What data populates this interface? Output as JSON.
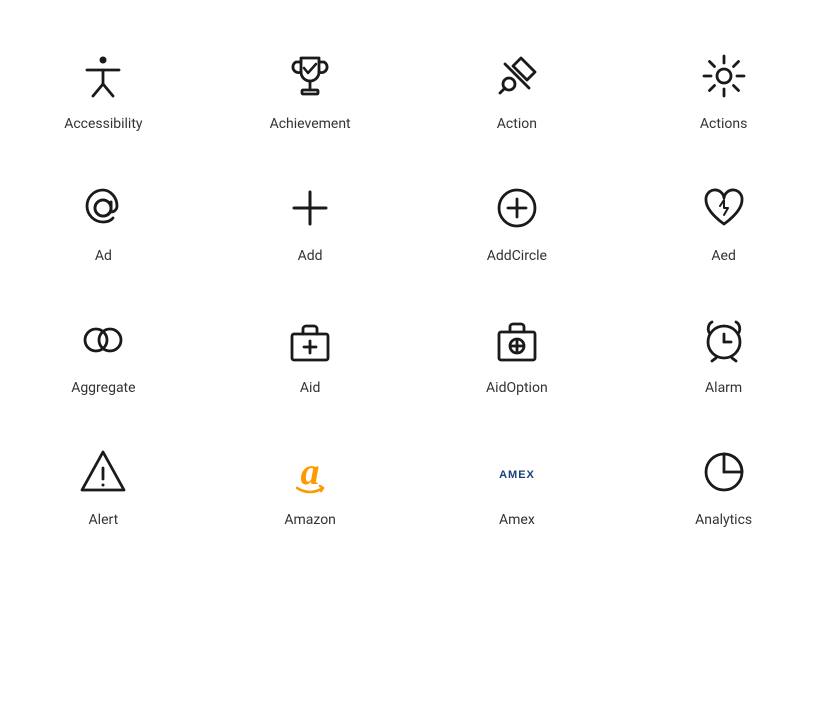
{
  "icons": [
    {
      "id": "accessibility",
      "label": "Accessibility"
    },
    {
      "id": "achievement",
      "label": "Achievement"
    },
    {
      "id": "action",
      "label": "Action"
    },
    {
      "id": "actions",
      "label": "Actions"
    },
    {
      "id": "ad",
      "label": "Ad"
    },
    {
      "id": "add",
      "label": "Add"
    },
    {
      "id": "addcircle",
      "label": "AddCircle"
    },
    {
      "id": "aed",
      "label": "Aed"
    },
    {
      "id": "aggregate",
      "label": "Aggregate"
    },
    {
      "id": "aid",
      "label": "Aid"
    },
    {
      "id": "aidoption",
      "label": "AidOption"
    },
    {
      "id": "alarm",
      "label": "Alarm"
    },
    {
      "id": "alert",
      "label": "Alert"
    },
    {
      "id": "amazon",
      "label": "Amazon"
    },
    {
      "id": "amex",
      "label": "Amex"
    },
    {
      "id": "analytics",
      "label": "Analytics"
    }
  ]
}
